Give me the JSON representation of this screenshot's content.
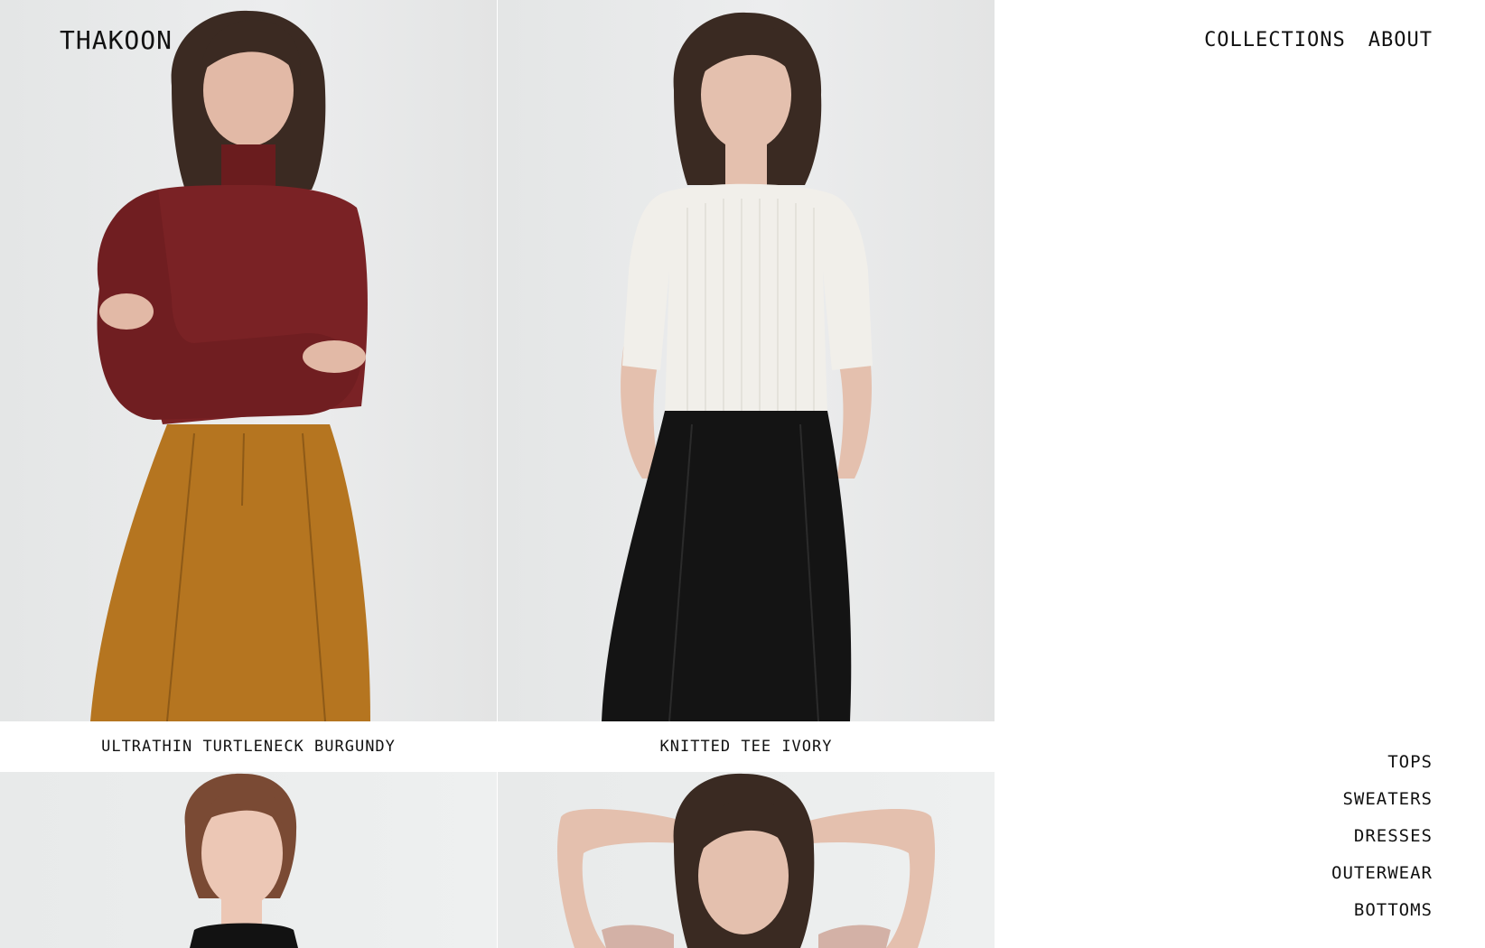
{
  "brand": {
    "logo_text": "THAKOON"
  },
  "header": {
    "nav": [
      {
        "label": "COLLECTIONS"
      },
      {
        "label": "ABOUT"
      }
    ]
  },
  "products": [
    {
      "name": "ULTRATHIN TURTLENECK BURGUNDY"
    },
    {
      "name": "KNITTED TEE IVORY"
    },
    {
      "name": ""
    },
    {
      "name": ""
    }
  ],
  "categories": [
    {
      "label": "TOPS"
    },
    {
      "label": "SWEATERS"
    },
    {
      "label": "DRESSES"
    },
    {
      "label": "OUTERWEAR"
    },
    {
      "label": "BOTTOMS"
    }
  ],
  "colors": {
    "background": "#ffffff",
    "text": "#111111",
    "photo_background": "#e8eaea"
  }
}
